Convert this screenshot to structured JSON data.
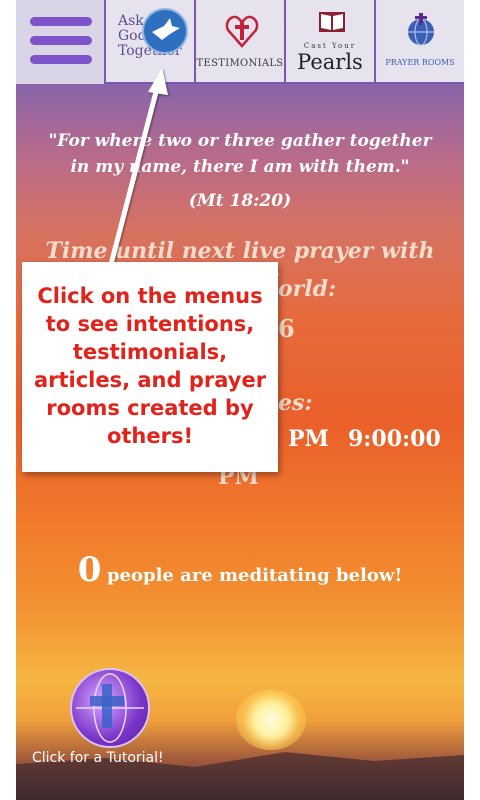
{
  "menu": {
    "ask_god_label_line1": "Ask",
    "ask_god_label_line2": "God",
    "ask_god_label_line3": "Together",
    "testimonials_label": "TESTIMONIALS",
    "pearls_small": "Cast Your",
    "pearls_large": "Pearls",
    "prayer_rooms_label": "PRAYER ROOMS"
  },
  "quote": {
    "text": "\"For where two or three gather together in my name, there I am with them.\"",
    "citation": "(Mt 18:20)"
  },
  "countdown": {
    "line1": "Time until next live prayer with others",
    "line2_partial": "orld:",
    "timer_partial": "6",
    "times_label_partial": "es:",
    "time_a_partial": "PM",
    "time_b": "9:00:00",
    "time_b_suffix": "PM"
  },
  "popup": {
    "text": "Click on the menus to see intentions, testimonials, articles, and prayer rooms created by others!"
  },
  "meditating": {
    "count": "0",
    "label": "people are meditating below!"
  },
  "tutorial": {
    "label": "Click for a Tutorial!"
  }
}
